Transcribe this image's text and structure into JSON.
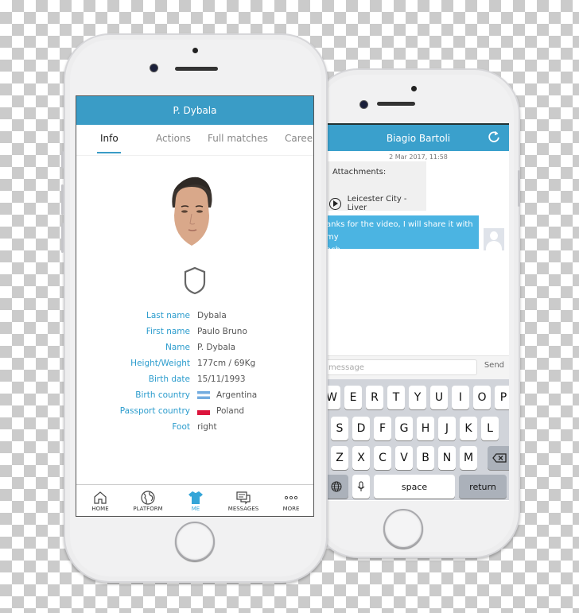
{
  "chat_screen": {
    "title": "Biagio Bartoli",
    "refresh_icon": "refresh-icon",
    "date": "2 Mar 2017, 11:58",
    "incoming": {
      "attachments_label": "Attachments:",
      "video_title": "Leicester City - Liver"
    },
    "outgoing": {
      "line1": "anks for the video, I will share it with my",
      "line2": "ach"
    },
    "compose": {
      "placeholder": "message",
      "send_label": "Send"
    },
    "keyboard": {
      "row1": [
        "W",
        "E",
        "R",
        "T",
        "Y",
        "U",
        "I",
        "O",
        "P"
      ],
      "row2": [
        "S",
        "D",
        "F",
        "G",
        "H",
        "J",
        "K",
        "L"
      ],
      "row3": [
        "Z",
        "X",
        "C",
        "V",
        "B",
        "N",
        "M"
      ],
      "space_label": "space",
      "return_label": "return"
    }
  },
  "profile_screen": {
    "title": "P. Dybala",
    "tabs": [
      {
        "label": "Info",
        "active": true
      },
      {
        "label": "Actions",
        "active": false
      },
      {
        "label": "Full matches",
        "active": false
      },
      {
        "label": "Career",
        "active": false
      }
    ],
    "fields": [
      {
        "label": "Last name",
        "value": "Dybala"
      },
      {
        "label": "First name",
        "value": "Paulo Bruno"
      },
      {
        "label": "Name",
        "value": "P. Dybala"
      },
      {
        "label": "Height/Weight",
        "value": "177cm / 69Kg"
      },
      {
        "label": "Birth date",
        "value": "15/11/1993"
      },
      {
        "label": "Birth country",
        "value": "Argentina",
        "flag": "argentina-flag"
      },
      {
        "label": "Passport country",
        "value": "Poland",
        "flag": "poland-flag"
      },
      {
        "label": "Foot",
        "value": "right"
      }
    ],
    "tabbar": [
      {
        "label": "HOME",
        "icon": "home-icon",
        "active": false
      },
      {
        "label": "PLATFORM",
        "icon": "globe-icon",
        "active": false
      },
      {
        "label": "ME",
        "icon": "shirt-icon",
        "active": true
      },
      {
        "label": "MESSAGES",
        "icon": "messages-icon",
        "active": false
      },
      {
        "label": "MORE",
        "icon": "more-icon",
        "active": false
      }
    ],
    "accent_color": "#3a9cc6"
  }
}
